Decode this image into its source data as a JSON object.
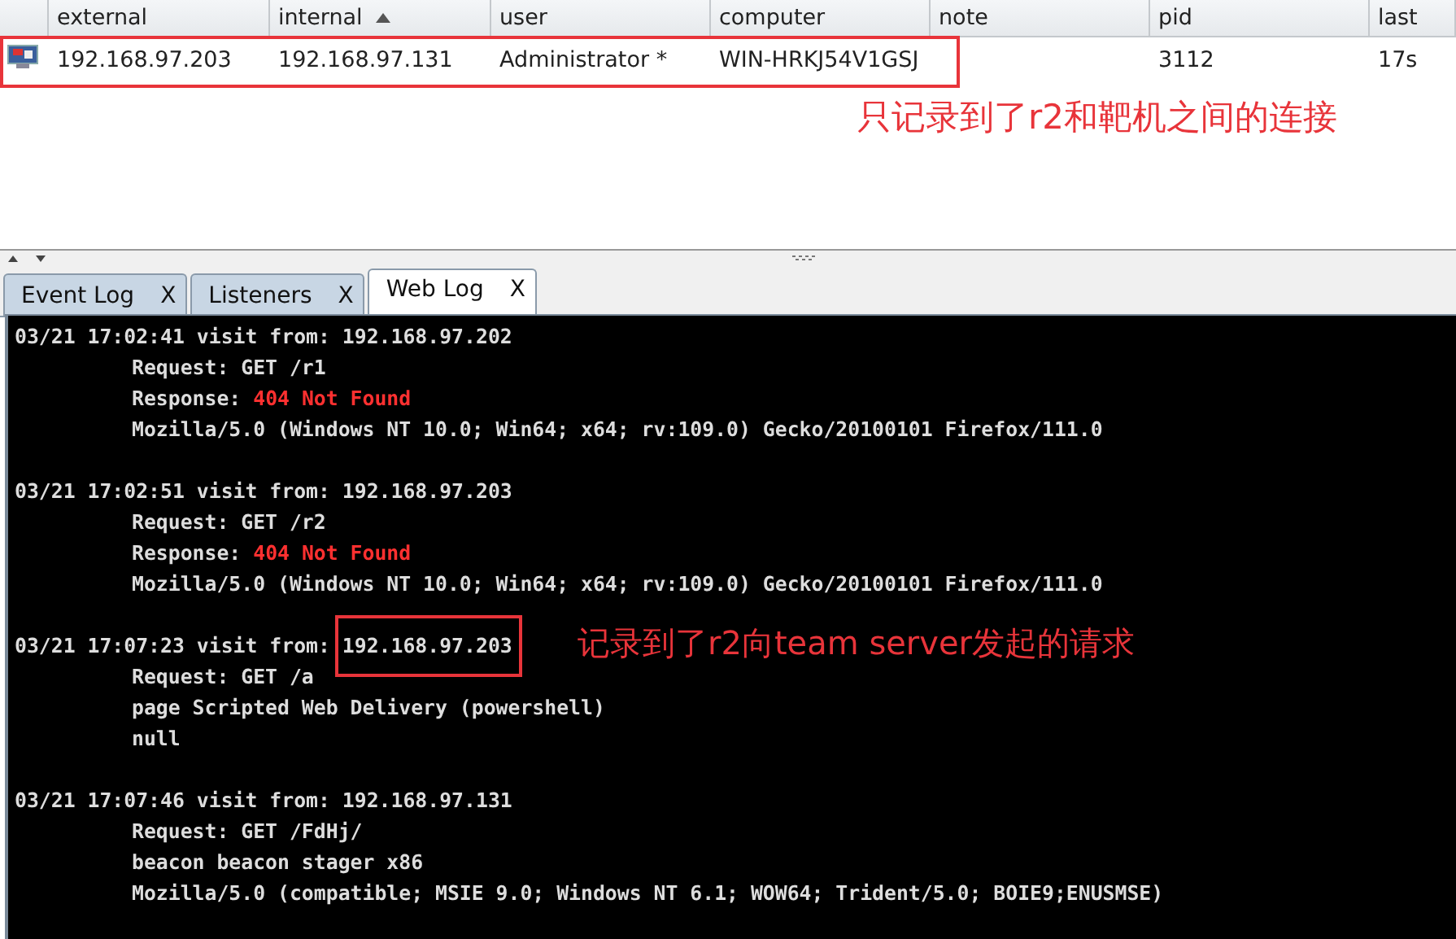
{
  "beacon_table": {
    "columns": [
      {
        "label": "external",
        "sorted": false
      },
      {
        "label": "internal",
        "sorted": true
      },
      {
        "label": "user",
        "sorted": false
      },
      {
        "label": "computer",
        "sorted": false
      },
      {
        "label": "note",
        "sorted": false
      },
      {
        "label": "pid",
        "sorted": false
      },
      {
        "label": "last",
        "sorted": false
      }
    ],
    "rows": [
      {
        "external": "192.168.97.203",
        "internal": "192.168.97.131",
        "user": "Administrator *",
        "computer": "WIN-HRKJ54V1GSJ",
        "pid": "3112",
        "last": "17s",
        "boxed": true
      }
    ]
  },
  "annotations": [
    {
      "text": "只记录到了r2和靶机之间的连接"
    },
    {
      "text": "记录到了r2向team server发起的请求"
    }
  ],
  "tabs": [
    {
      "label": "Event Log",
      "close": "X",
      "selected": false
    },
    {
      "label": "Listeners",
      "close": "X",
      "selected": false
    },
    {
      "label": "Web Log",
      "close": "X",
      "selected": true
    }
  ],
  "web_log": [
    {
      "timestamp": "03/21 17:02:41",
      "label": "visit from:",
      "ip": "192.168.97.202",
      "boxed": false,
      "lines": [
        {
          "kind": "request",
          "label": "Request:",
          "value": "GET /r1"
        },
        {
          "kind": "response",
          "label": "Response:",
          "value": "404 Not Found"
        },
        {
          "kind": "text",
          "text": "Mozilla/5.0 (Windows NT 10.0; Win64; x64; rv:109.0) Gecko/20100101 Firefox/111.0"
        }
      ]
    },
    {
      "timestamp": "03/21 17:02:51",
      "label": "visit from:",
      "ip": "192.168.97.203",
      "boxed": false,
      "lines": [
        {
          "kind": "request",
          "label": "Request:",
          "value": "GET /r2"
        },
        {
          "kind": "response",
          "label": "Response:",
          "value": "404 Not Found"
        },
        {
          "kind": "text",
          "text": "Mozilla/5.0 (Windows NT 10.0; Win64; x64; rv:109.0) Gecko/20100101 Firefox/111.0"
        }
      ]
    },
    {
      "timestamp": "03/21 17:07:23",
      "label": "visit from:",
      "ip": "192.168.97.203",
      "boxed": true,
      "lines": [
        {
          "kind": "request",
          "label": "Request:",
          "value": "GET /a"
        },
        {
          "kind": "text",
          "text": "page Scripted Web Delivery (powershell)"
        },
        {
          "kind": "text",
          "text": "null"
        }
      ]
    },
    {
      "timestamp": "03/21 17:07:46",
      "label": "visit from:",
      "ip": "192.168.97.131",
      "boxed": false,
      "lines": [
        {
          "kind": "request",
          "label": "Request:",
          "value": "GET /FdHj/"
        },
        {
          "kind": "text",
          "text": "beacon beacon stager x86"
        },
        {
          "kind": "text",
          "text": "Mozilla/5.0 (compatible; MSIE 9.0; Windows NT 6.1; WOW64; Trident/5.0; BOIE9;ENUSMSE)"
        }
      ]
    }
  ]
}
